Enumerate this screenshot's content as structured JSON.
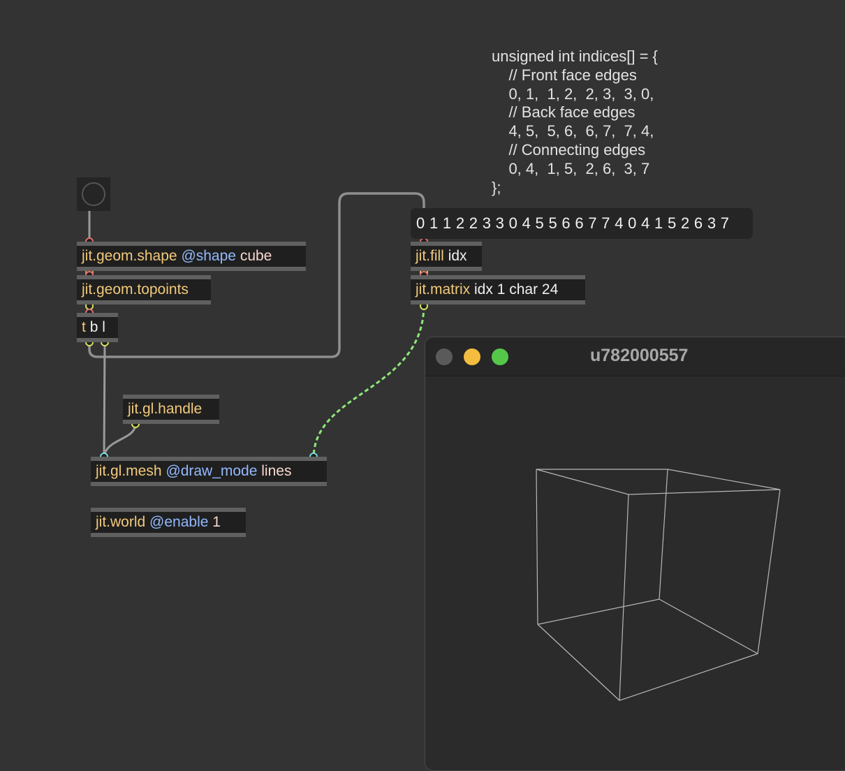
{
  "comment": {
    "lines": [
      "unsigned int indices[] = {",
      "    // Front face edges",
      "    0, 1,  1, 2,  2, 3,  3, 0,",
      "    // Back face edges",
      "    4, 5,  5, 6,  6, 7,  7, 4,",
      "    // Connecting edges",
      "    0, 4,  1, 5,  2, 6,  3, 7",
      "};"
    ]
  },
  "message": {
    "text": "0 1 1 2 2 3 3 0 4 5 5 6 6 7 7 4 0 4 1 5 2 6 3 7"
  },
  "objects": {
    "geom_shape": {
      "name": "jit.geom.shape",
      "attr": "@shape",
      "value": "cube"
    },
    "geom_topoints": {
      "name": "jit.geom.topoints"
    },
    "trigger": {
      "name": "t",
      "args": "b l"
    },
    "gl_handle": {
      "name": "jit.gl.handle"
    },
    "gl_mesh": {
      "name": "jit.gl.mesh",
      "attr": "@draw_mode",
      "value": "lines"
    },
    "world": {
      "name": "jit.world",
      "attr": "@enable",
      "value": "1"
    },
    "fill": {
      "name": "jit.fill",
      "args": "idx"
    },
    "matrix": {
      "name": "jit.matrix",
      "args": "idx 1 char 24"
    }
  },
  "window": {
    "title": "u782000557"
  },
  "colors": {
    "background": "#333333",
    "object_name": "#f2c97a",
    "attribute": "#93b9ff",
    "attribute_value": "#f8d9ce",
    "matrix_cord": "#8ee87a",
    "patch_cord": "#9a9a9a"
  }
}
